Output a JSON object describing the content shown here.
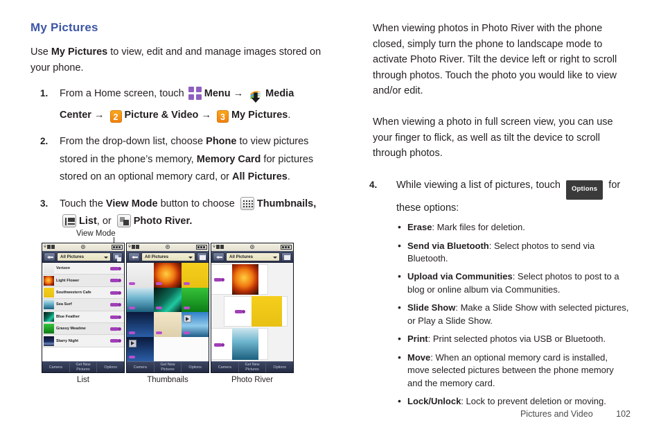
{
  "section": {
    "title": "My Pictures",
    "intro_prefix": "Use ",
    "intro_bold": "My Pictures",
    "intro_suffix": " to view, edit and and manage images stored on your phone."
  },
  "steps": [
    {
      "num": "1.",
      "parts": [
        {
          "t": "text",
          "v": "From a Home screen, touch "
        },
        {
          "t": "icon",
          "v": "menu-grid-icon"
        },
        {
          "t": "bold",
          "v": "Menu"
        },
        {
          "t": "arrow",
          "v": "→"
        },
        {
          "t": "icon",
          "v": "media-center-icon"
        },
        {
          "t": "bold",
          "v": "Media Center"
        },
        {
          "t": "arrow",
          "v": "→"
        },
        {
          "t": "badge",
          "v": "2"
        },
        {
          "t": "bold",
          "v": "Picture & Video"
        },
        {
          "t": "arrow",
          "v": "→"
        },
        {
          "t": "badge",
          "v": "3"
        },
        {
          "t": "bold",
          "v": "My Pictures"
        },
        {
          "t": "text",
          "v": "."
        }
      ]
    },
    {
      "num": "2.",
      "text_a": "From the drop-down list, choose ",
      "bold_a": "Phone",
      "text_b": " to view pictures stored in the phone’s memory, ",
      "bold_b": "Memory Card",
      "text_c": " for pictures stored on an optional memory card, or ",
      "bold_c": "All Pictures",
      "text_d": "."
    },
    {
      "num": "3.",
      "text_a": "Touch the ",
      "bold_a": "View Mode",
      "text_b": " button to choose ",
      "bold_thumbnails": "Thumbnails,",
      "bold_list": "List",
      "text_or": ", or ",
      "bold_river": "Photo River.",
      "icons": [
        "thumbnails-view-icon",
        "list-view-icon",
        "photo-river-view-icon"
      ]
    }
  ],
  "right": {
    "para1": "When viewing photos in Photo River with the phone closed, simply turn the phone to landscape mode to activate Photo River. Tilt the device left or right to scroll through photos. Touch the photo you would like to view and/or edit.",
    "para2": "When viewing a photo in full screen view, you can use your finger to flick, as well as tilt the device to scroll through photos.",
    "step4": {
      "num": "4.",
      "text_a": "While viewing a list of pictures, touch ",
      "button_label": "Options",
      "text_b": " for these options:"
    },
    "options": [
      {
        "term": "Erase",
        "desc": ": Mark files for deletion."
      },
      {
        "term": "Send via Bluetooth",
        "desc": ": Select photos to send via Bluetooth."
      },
      {
        "term": "Upload via Communities",
        "desc": ": Select photos to post to a blog or online album via Communities."
      },
      {
        "term": "Slide Show",
        "desc": ": Make a Slide Show with selected pictures, or Play a Slide Show."
      },
      {
        "term": "Print",
        "desc": ": Print selected photos via USB or Bluetooth."
      },
      {
        "term": "Move",
        "desc": ": When an optional memory card is installed, move selected pictures between the phone memory and the memory card."
      },
      {
        "term": "Lock/Unlock",
        "desc": ": Lock to prevent deletion or moving."
      }
    ]
  },
  "figure": {
    "callout_label": "View Mode",
    "captions": [
      "List",
      "Thumbnails",
      "Photo River"
    ],
    "dropdown_value": "All Pictures",
    "bottom_bar": [
      "Camera",
      "Get New Pictures",
      "Options"
    ],
    "list_items": [
      "Verizon",
      "Light Flower",
      "Southwestern Cafe",
      "Sea Surf",
      "Blue Feather",
      "Grassy Meadow",
      "Starry Night"
    ]
  },
  "footer": {
    "chapter": "Pictures and Video",
    "page": "102"
  },
  "colors": {
    "title_blue": "#3c56a5",
    "badge_orange": "#f08010",
    "menu_purple": "#8f5fc0",
    "body_text": "#231f20",
    "options_button_bg": "#3b3b3b"
  }
}
